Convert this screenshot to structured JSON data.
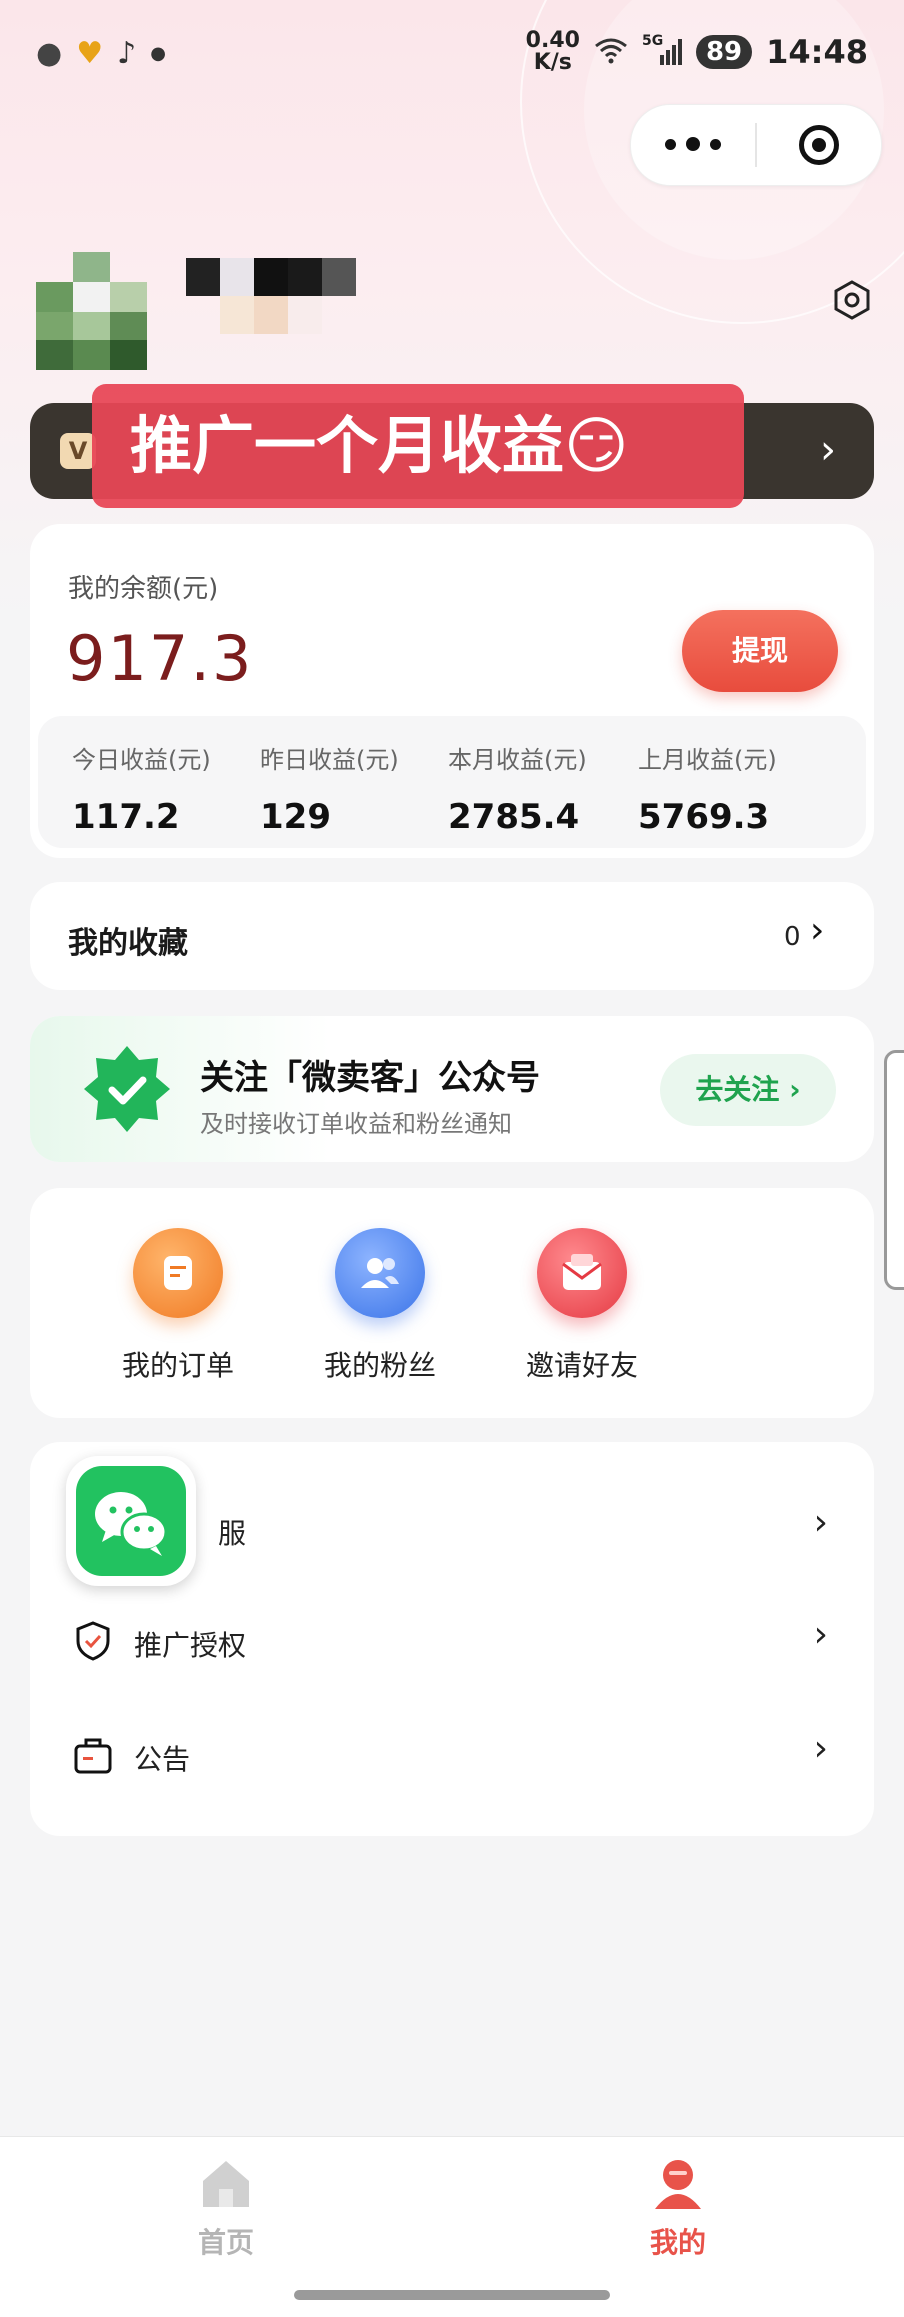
{
  "status_bar": {
    "speed_value": "0.40",
    "speed_unit": "K/s",
    "network": "5G",
    "battery": "89",
    "time": "14:48"
  },
  "overlay_caption": "推广一个月收益😏",
  "balance": {
    "label": "我的余额(元)",
    "value": "917.3",
    "withdraw_label": "提现"
  },
  "stats": [
    {
      "label": "今日收益(元)",
      "value": "117.2"
    },
    {
      "label": "昨日收益(元)",
      "value": "129"
    },
    {
      "label": "本月收益(元)",
      "value": "2785.4"
    },
    {
      "label": "上月收益(元)",
      "value": "5769.3"
    }
  ],
  "favorites": {
    "title": "我的收藏",
    "count": "0"
  },
  "follow": {
    "title": "关注「微卖客」公众号",
    "subtitle": "及时接收订单收益和粉丝通知",
    "button_label": "去关注"
  },
  "shortcuts": [
    {
      "label": "我的订单",
      "icon": "orders-icon",
      "color": "#f7963a"
    },
    {
      "label": "我的粉丝",
      "icon": "fans-icon",
      "color": "#4a84f0"
    },
    {
      "label": "邀请好友",
      "icon": "invite-icon",
      "color": "#ee4b51"
    }
  ],
  "menu": [
    {
      "label": "服",
      "icon": "customer-service-icon"
    },
    {
      "label": "推广授权",
      "icon": "shield-icon"
    },
    {
      "label": "公告",
      "icon": "announcement-icon"
    }
  ],
  "tabs": [
    {
      "label": "首页",
      "icon": "home-icon",
      "active": false
    },
    {
      "label": "我的",
      "icon": "profile-icon",
      "active": true
    }
  ],
  "colors": {
    "accent_red": "#e84c3d",
    "balance_text": "#7b1d1d",
    "follow_green": "#1fa34e",
    "wechat_green": "#22c260"
  }
}
